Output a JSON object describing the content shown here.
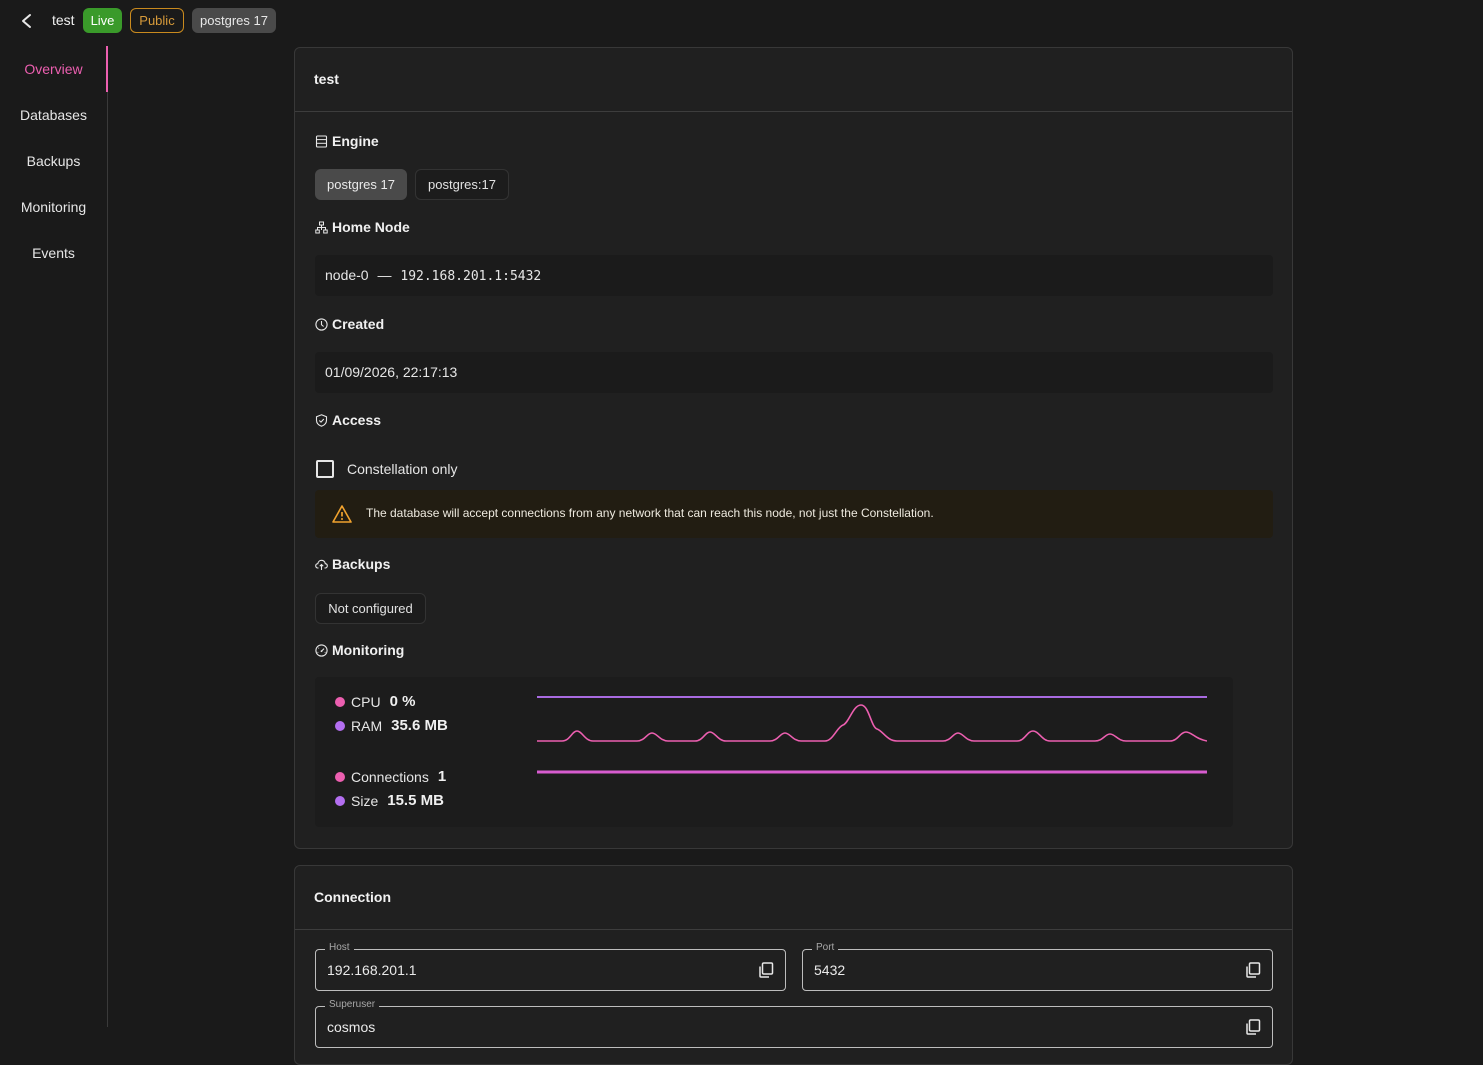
{
  "header": {
    "title": "test",
    "status_badge": "Live",
    "visibility_badge": "Public",
    "engine_badge": "postgres 17"
  },
  "sidebar": {
    "items": [
      {
        "label": "Overview",
        "active": true
      },
      {
        "label": "Databases"
      },
      {
        "label": "Backups"
      },
      {
        "label": "Monitoring"
      },
      {
        "label": "Events"
      }
    ]
  },
  "overview": {
    "title": "test",
    "engine": {
      "label": "Engine",
      "selected": "postgres 17",
      "image": "postgres:17"
    },
    "home_node": {
      "label": "Home Node",
      "node": "node-0",
      "separator": "—",
      "address": "192.168.201.1:5432"
    },
    "created": {
      "label": "Created",
      "value": "01/09/2026, 22:17:13"
    },
    "access": {
      "label": "Access",
      "checkbox_label": "Constellation only",
      "checked": false,
      "warning": "The database will accept connections from any network that can reach this node, not just the Constellation."
    },
    "backups": {
      "label": "Backups",
      "status": "Not configured"
    },
    "monitoring": {
      "label": "Monitoring",
      "metrics": [
        {
          "name": "CPU",
          "value": "0 %",
          "color": "#ec5fb0"
        },
        {
          "name": "RAM",
          "value": "35.6 MB",
          "color": "#b36ef0"
        },
        {
          "name": "Connections",
          "value": "1",
          "color": "#ec5fb0"
        },
        {
          "name": "Size",
          "value": "15.5 MB",
          "color": "#b36ef0"
        }
      ]
    }
  },
  "connection": {
    "title": "Connection",
    "host": {
      "label": "Host",
      "value": "192.168.201.1"
    },
    "port": {
      "label": "Port",
      "value": "5432"
    },
    "superuser": {
      "label": "Superuser",
      "value": "cosmos"
    }
  },
  "colors": {
    "accent": "#ec5fb0",
    "live": "#3a9a2a",
    "public": "#c98a1e",
    "purple": "#b36ef0"
  },
  "icons": [
    "back-chevron-icon",
    "database-icon",
    "network-icon",
    "clock-icon",
    "shield-icon",
    "warning-icon",
    "cloud-upload-icon",
    "gauge-icon",
    "copy-icon"
  ]
}
